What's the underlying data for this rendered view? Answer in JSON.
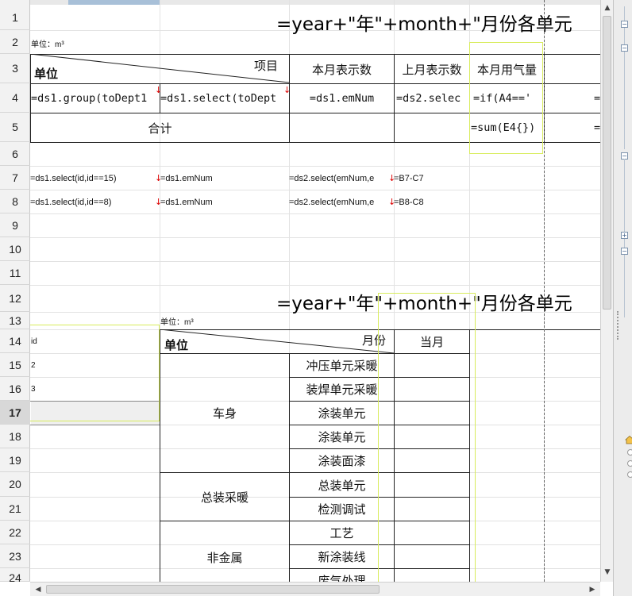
{
  "rows": [
    "1",
    "2",
    "3",
    "4",
    "5",
    "6",
    "7",
    "8",
    "9",
    "10",
    "11",
    "12",
    "13",
    "14",
    "15",
    "16",
    "17",
    "18",
    "19",
    "20",
    "21",
    "22",
    "23",
    "24"
  ],
  "active_row": "17",
  "report1": {
    "title": "=year+\"年\"+month+\"月份各单元",
    "unit_label": "单位：m³",
    "header_diag_top": "项目",
    "header_diag_bottom": "单位",
    "col_c": "本月表示数",
    "col_d": "上月表示数",
    "col_e": "本月用气量",
    "row4": {
      "a": "=ds1.group(toDept1",
      "b": "=ds1.select(toDept",
      "c": "=ds1.emNum",
      "d": "=ds2.selec",
      "e": "=if(A4=='",
      "f": "="
    },
    "row5": {
      "total": "合计",
      "e": "=sum(E4{})",
      "f": "="
    }
  },
  "aux": {
    "r7": {
      "a": "=ds1.select(id,id==15)",
      "b": "=ds1.emNum",
      "c": "=ds2.select(emNum,e",
      "d": "=B7-C7"
    },
    "r8": {
      "a": "=ds1.select(id,id==8)",
      "b": "=ds1.emNum",
      "c": "=ds2.select(emNum,e",
      "d": "=B8-C8"
    }
  },
  "report2": {
    "title": "=year+\"年\"+month+\"月份各单元",
    "unit_label": "单位：m³",
    "header_diag_top": "月份",
    "header_diag_bottom": "单位",
    "col_current": "当月",
    "ids": [
      "id",
      "2",
      "3"
    ],
    "groups": [
      {
        "name": "车身",
        "items": [
          "冲压单元采暖",
          "装焊单元采暖",
          "涂装单元",
          "涂装单元",
          "涂装面漆"
        ]
      },
      {
        "name": "总装采暖",
        "items": [
          "总装单元",
          "检测调试"
        ]
      },
      {
        "name": "非金属",
        "items": [
          "工艺",
          "新涂装线",
          "废气处理"
        ]
      }
    ]
  }
}
